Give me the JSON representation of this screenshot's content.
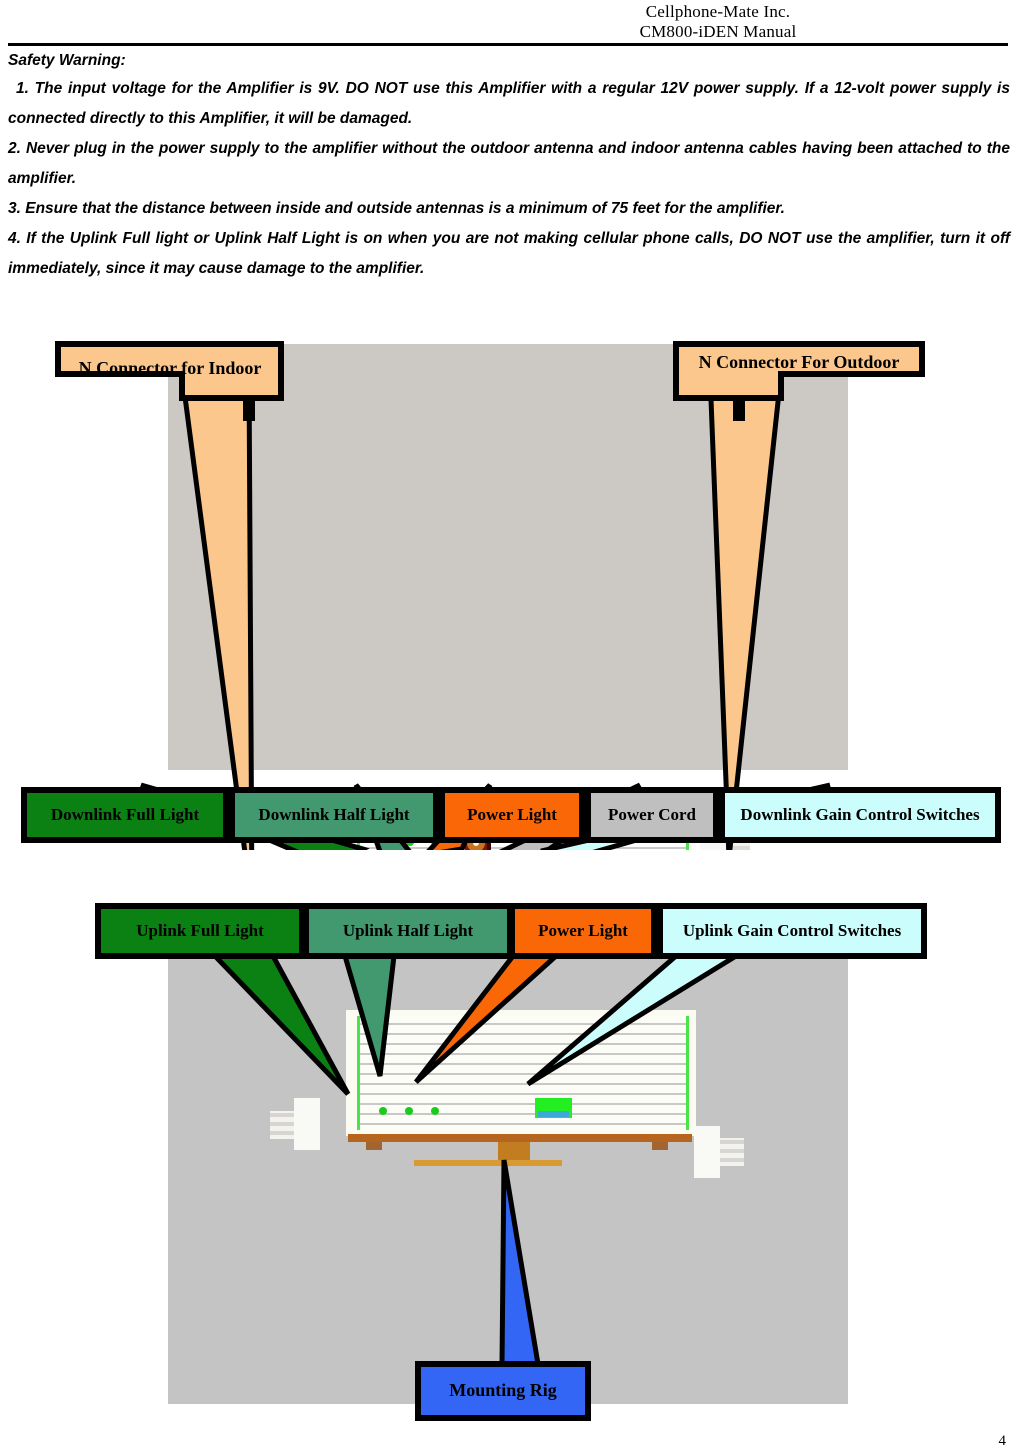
{
  "header": {
    "company": "Cellphone-Mate  Inc.",
    "manual": "CM800-iDEN  Manual"
  },
  "safety": {
    "title": "Safety Warning:",
    "items": [
      "1. The input voltage for the Amplifier is 9V.   DO NOT use this Amplifier with a regular 12V power supply.   If a 12-volt power supply is connected directly to this Amplifier, it will be damaged.",
      "2. Never plug in the power supply to the amplifier without the outdoor antenna and indoor antenna cables having been attached to the amplifier.",
      "3. Ensure that the distance between inside and outside antennas is a minimum of 75 feet for the amplifier.",
      "4. If the Uplink Full light or Uplink Half Light is on when you are not making cellular phone calls, DO NOT use the amplifier, turn it off immediately, since it may cause damage to the amplifier."
    ]
  },
  "figure_downlink": {
    "top_callouts": [
      {
        "label": "N Connector for Indoor",
        "color": "#fbc78d"
      },
      {
        "label": "N Connector For Outdoor",
        "color": "#fbc78d"
      }
    ],
    "bottom_callouts": [
      {
        "label": "Downlink Full Light",
        "color": "#0b8013"
      },
      {
        "label": "Downlink Half Light",
        "color": "#42996f"
      },
      {
        "label": "Power Light",
        "color": "#f96707"
      },
      {
        "label": "Power Cord",
        "color": "#bfbfbf"
      },
      {
        "label": "Downlink Gain Control Switches",
        "color": "#ccfdfd"
      }
    ]
  },
  "figure_uplink": {
    "top_callouts": [
      {
        "label": "Uplink Full Light",
        "color": "#0b8013"
      },
      {
        "label": "Uplink Half Light",
        "color": "#42996f"
      },
      {
        "label": "Power Light",
        "color": "#f96707"
      },
      {
        "label": "Uplink Gain Control Switches",
        "color": "#ccfdfd"
      }
    ],
    "bottom_callouts": [
      {
        "label": "Mounting Rig",
        "color": "#3366f5"
      }
    ]
  },
  "page_number": "4"
}
